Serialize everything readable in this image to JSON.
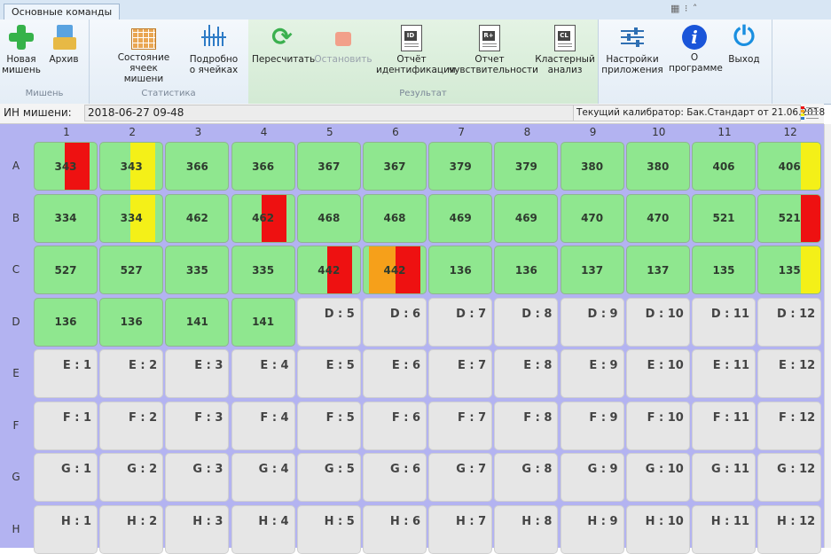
{
  "ribbon": {
    "tab": "Основные команды",
    "window_controls": "▦ ⁝ ˄",
    "groups": {
      "target": {
        "caption": "Мишень",
        "new_target": "Новая\nмишень",
        "archive": "Архив"
      },
      "statistics": {
        "caption": "Статистика",
        "cell_state": "Состояние ячеек\nмишени",
        "cell_details": "Подробно\nо ячейках"
      },
      "result": {
        "caption": "Результат",
        "recalc": "Пересчитать",
        "stop": "Остановить",
        "id_report": "Отчёт\nидентификации",
        "sens_report": "Отчет\nчувствительности",
        "cluster": "Кластерный\nанализ",
        "id_tag": "ID",
        "sens_tag": "R+",
        "cl_tag": "CL"
      },
      "app": {
        "settings": "Настройки\nприложения",
        "about": "О\nпрограмме",
        "exit": "Выход",
        "info_glyph": "i",
        "power_glyph": "⏻"
      }
    }
  },
  "infobar": {
    "id_label": "ИН мишени:",
    "id_value": "2018-06-27 09-48",
    "calibrator": "Текущий калибратор: Бак.Стандарт от 21.06.2018"
  },
  "plate": {
    "columns": [
      "1",
      "2",
      "3",
      "4",
      "5",
      "6",
      "7",
      "8",
      "9",
      "10",
      "11",
      "12"
    ],
    "rows": [
      "A",
      "B",
      "C",
      "D",
      "E",
      "F",
      "G",
      "H"
    ],
    "colors": {
      "well_green": "#8fe78f",
      "flag_red": "#ee1111",
      "flag_yellow": "#f4f018",
      "flag_orange": "#f6a01a",
      "empty": "#e6e6e6",
      "plate_bg": "#b3b3f1"
    },
    "wells": [
      [
        {
          "t": "343",
          "f": "red"
        },
        {
          "t": "343",
          "f": "yellow"
        },
        {
          "t": "366"
        },
        {
          "t": "366"
        },
        {
          "t": "367"
        },
        {
          "t": "367"
        },
        {
          "t": "379"
        },
        {
          "t": "379"
        },
        {
          "t": "380"
        },
        {
          "t": "380"
        },
        {
          "t": "406"
        },
        {
          "t": "406",
          "f": "yellow"
        }
      ],
      [
        {
          "t": "334"
        },
        {
          "t": "334",
          "f": "yellow"
        },
        {
          "t": "462"
        },
        {
          "t": "462",
          "f": "red"
        },
        {
          "t": "468"
        },
        {
          "t": "468"
        },
        {
          "t": "469"
        },
        {
          "t": "469"
        },
        {
          "t": "470"
        },
        {
          "t": "470"
        },
        {
          "t": "521"
        },
        {
          "t": "521",
          "f": "red"
        }
      ],
      [
        {
          "t": "527"
        },
        {
          "t": "527"
        },
        {
          "t": "335"
        },
        {
          "t": "335"
        },
        {
          "t": "442",
          "f": "red"
        },
        {
          "t": "442",
          "f": "orange-red"
        },
        {
          "t": "136"
        },
        {
          "t": "136"
        },
        {
          "t": "137"
        },
        {
          "t": "137"
        },
        {
          "t": "135"
        },
        {
          "t": "135",
          "f": "yellow"
        }
      ],
      [
        {
          "t": "136"
        },
        {
          "t": "136"
        },
        {
          "t": "141"
        },
        {
          "t": "141"
        },
        {
          "t": "D : 5",
          "e": true
        },
        {
          "t": "D : 6",
          "e": true
        },
        {
          "t": "D : 7",
          "e": true
        },
        {
          "t": "D : 8",
          "e": true
        },
        {
          "t": "D : 9",
          "e": true
        },
        {
          "t": "D : 10",
          "e": true
        },
        {
          "t": "D : 11",
          "e": true
        },
        {
          "t": "D : 12",
          "e": true
        }
      ],
      [
        {
          "t": "E : 1",
          "e": true
        },
        {
          "t": "E : 2",
          "e": true
        },
        {
          "t": "E : 3",
          "e": true
        },
        {
          "t": "E : 4",
          "e": true
        },
        {
          "t": "E : 5",
          "e": true
        },
        {
          "t": "E : 6",
          "e": true
        },
        {
          "t": "E : 7",
          "e": true
        },
        {
          "t": "E : 8",
          "e": true
        },
        {
          "t": "E : 9",
          "e": true
        },
        {
          "t": "E : 10",
          "e": true
        },
        {
          "t": "E : 11",
          "e": true
        },
        {
          "t": "E : 12",
          "e": true
        }
      ],
      [
        {
          "t": "F : 1",
          "e": true
        },
        {
          "t": "F : 2",
          "e": true
        },
        {
          "t": "F : 3",
          "e": true
        },
        {
          "t": "F : 4",
          "e": true
        },
        {
          "t": "F : 5",
          "e": true
        },
        {
          "t": "F : 6",
          "e": true
        },
        {
          "t": "F : 7",
          "e": true
        },
        {
          "t": "F : 8",
          "e": true
        },
        {
          "t": "F : 9",
          "e": true
        },
        {
          "t": "F : 10",
          "e": true
        },
        {
          "t": "F : 11",
          "e": true
        },
        {
          "t": "F : 12",
          "e": true
        }
      ],
      [
        {
          "t": "G : 1",
          "e": true
        },
        {
          "t": "G : 2",
          "e": true
        },
        {
          "t": "G : 3",
          "e": true
        },
        {
          "t": "G : 4",
          "e": true
        },
        {
          "t": "G : 5",
          "e": true
        },
        {
          "t": "G : 6",
          "e": true
        },
        {
          "t": "G : 7",
          "e": true
        },
        {
          "t": "G : 8",
          "e": true
        },
        {
          "t": "G : 9",
          "e": true
        },
        {
          "t": "G : 10",
          "e": true
        },
        {
          "t": "G : 11",
          "e": true
        },
        {
          "t": "G : 12",
          "e": true
        }
      ],
      [
        {
          "t": "H : 1",
          "e": true
        },
        {
          "t": "H : 2",
          "e": true
        },
        {
          "t": "H : 3",
          "e": true
        },
        {
          "t": "H : 4",
          "e": true
        },
        {
          "t": "H : 5",
          "e": true
        },
        {
          "t": "H : 6",
          "e": true
        },
        {
          "t": "H : 7",
          "e": true
        },
        {
          "t": "H : 8",
          "e": true
        },
        {
          "t": "H : 9",
          "e": true
        },
        {
          "t": "H : 10",
          "e": true
        },
        {
          "t": "H : 11",
          "e": true
        },
        {
          "t": "H : 12",
          "e": true
        }
      ]
    ]
  }
}
